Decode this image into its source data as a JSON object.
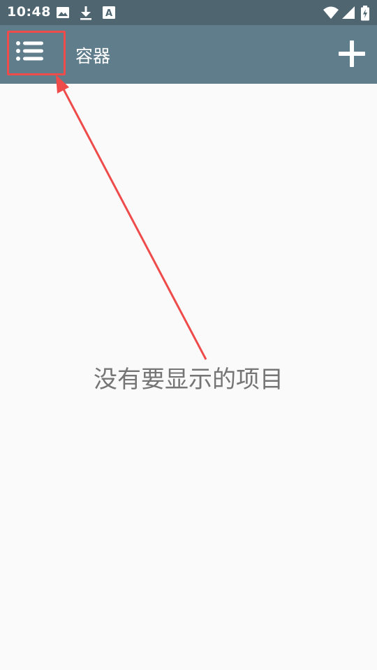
{
  "status_bar": {
    "time": "10:48",
    "left_icons": [
      "image-icon",
      "download-icon",
      "font-a-icon"
    ],
    "right_icons": [
      "wifi-icon",
      "signal-icon",
      "battery-charging-icon"
    ],
    "background": "#4f6671"
  },
  "app_bar": {
    "title": "容器",
    "menu_icon": "list-menu-icon",
    "add_icon": "plus-icon",
    "background": "#607d8b",
    "highlight_color": "#ef4b4b"
  },
  "main": {
    "empty_message": "没有要显示的项目",
    "background": "#fafafa"
  },
  "annotation": {
    "type": "arrow",
    "target": "menu-button",
    "color": "#ef4b4b"
  }
}
